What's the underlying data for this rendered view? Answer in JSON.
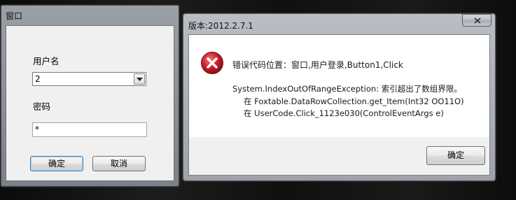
{
  "login_window": {
    "title": "窗口",
    "username_label": "用户名",
    "username_value": "2",
    "password_label": "密码",
    "password_value": "*",
    "ok_label": "确定",
    "cancel_label": "取消"
  },
  "error_dialog": {
    "title": "版本:2012.2.7.1",
    "icon": "error-icon",
    "message": "错误代码位置：窗口,用户登录,Button1,Click",
    "exception": "System.IndexOutOfRangeException: 索引超出了数组界限。",
    "stack_line_1": "在 Foxtable.DataRowCollection.get_Item(Int32 OO11O)",
    "stack_line_2": "在 UserCode.Click_1123e030(ControlEventArgs e)",
    "ok_label": "确定"
  },
  "colors": {
    "error_red": "#c8232c",
    "focus_border": "#3c7fb1"
  }
}
